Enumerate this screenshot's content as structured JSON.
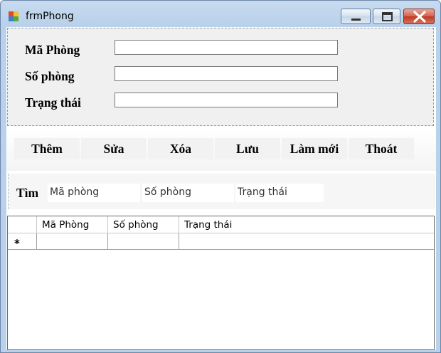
{
  "window": {
    "title": "frmPhong",
    "icons": {
      "app": "form-app-icon",
      "minimize": "minimize-icon",
      "maximize": "maximize-icon",
      "close": "close-icon"
    }
  },
  "fields": [
    {
      "label": "Mã Phòng",
      "value": ""
    },
    {
      "label": "Số phòng",
      "value": ""
    },
    {
      "label": "Trạng thái",
      "value": ""
    }
  ],
  "buttons": [
    "Thêm",
    "Sửa",
    "Xóa",
    "Lưu",
    "Làm mới",
    "Thoát"
  ],
  "search": {
    "label": "Tìm",
    "placeholders": [
      "Mã phòng",
      "Số phòng",
      "Trạng thái"
    ]
  },
  "grid": {
    "columns": [
      "Mã Phòng",
      "Số phòng",
      "Trạng thái"
    ],
    "rows": [],
    "new_row_marker": "*"
  },
  "colors": {
    "close_button": "#c23a22",
    "title_bar": "#b9d1ea",
    "panel": "#f0f0f0"
  }
}
